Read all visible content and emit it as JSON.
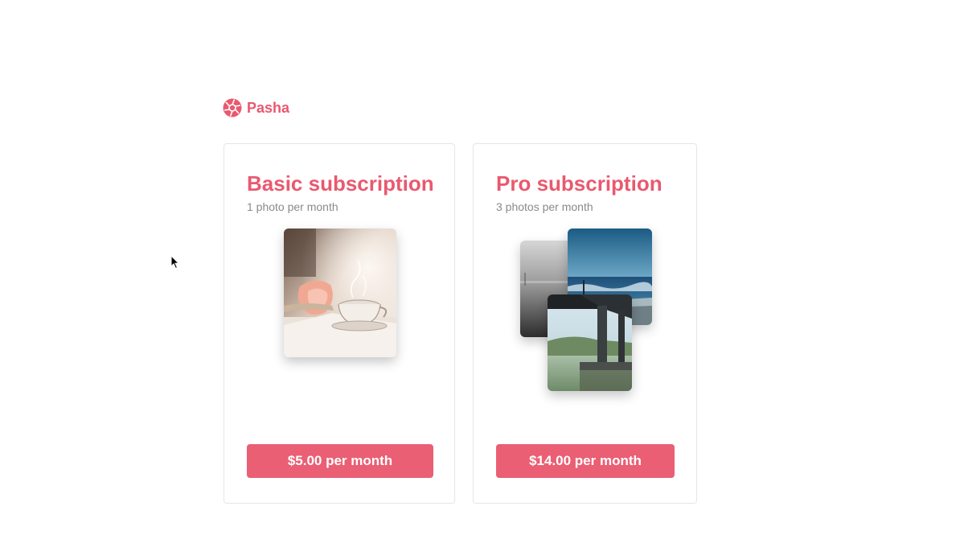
{
  "brand": {
    "name": "Pasha",
    "color": "#e9596f"
  },
  "plans": [
    {
      "title": "Basic subscription",
      "subtitle": "1 photo per month",
      "button_label": "$5.00 per month"
    },
    {
      "title": "Pro subscription",
      "subtitle": "3 photos per month",
      "button_label": "$14.00 per month"
    }
  ],
  "colors": {
    "accent": "#e9596f",
    "button": "#ea5f74",
    "subtitle": "#8a8a8a",
    "card_border": "#e6e6e6"
  },
  "icons": {
    "brand_logo": "camera-aperture-icon",
    "cursor": "mouse-pointer"
  }
}
